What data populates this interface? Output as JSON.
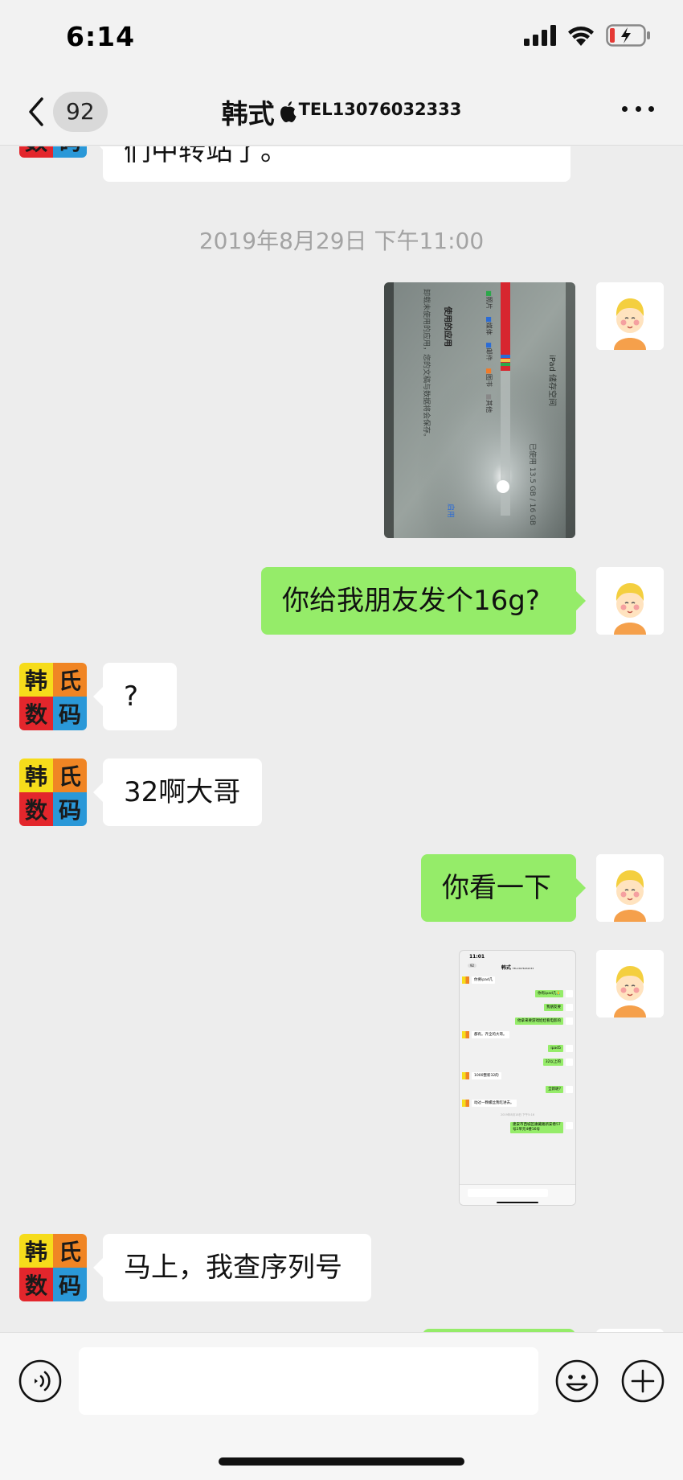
{
  "status_bar": {
    "time": "6:14"
  },
  "nav": {
    "unread_count": "92",
    "contact_name": "韩式",
    "contact_tel": "TEL13076032333"
  },
  "chat": {
    "partial_top_text": "们中转站了。",
    "timestamp": "2019年8月29日 下午11:00",
    "messages": [
      {
        "side": "out",
        "kind": "image",
        "image": "ipad-storage-photo"
      },
      {
        "side": "out",
        "kind": "text",
        "text": "你给我朋友发个16g?"
      },
      {
        "side": "in",
        "kind": "text",
        "text": "?"
      },
      {
        "side": "in",
        "kind": "text",
        "text": "32啊大哥"
      },
      {
        "side": "out",
        "kind": "text",
        "text": "你看一下"
      },
      {
        "side": "out",
        "kind": "image",
        "image": "chat-screenshot"
      },
      {
        "side": "in",
        "kind": "text",
        "text": "马上，我查序列号"
      }
    ]
  },
  "avatar_logo": {
    "chars": [
      "韩",
      "氏",
      "数",
      "码"
    ]
  },
  "photo": {
    "title": "iPad 储存空间",
    "used": "已使用 13.5 GB / 16 GB",
    "legend": [
      "照片",
      "媒体",
      "邮件",
      "图书",
      "其他"
    ],
    "section": "使用的应用",
    "hint": "卸载未使用的应用，您的文稿与数据将会保存。",
    "link": "启用"
  },
  "screenshot": {
    "time": "11:01",
    "title": "韩式",
    "tel": "TEL13076032333",
    "badge": "92",
    "rows": [
      {
        "side": "in",
        "text": "你要ipad几"
      },
      {
        "side": "out",
        "text": "你有ipad几🙏"
      },
      {
        "side": "out",
        "text": "我朋友要"
      },
      {
        "side": "out",
        "text": "他拿来要游戏娃娃看电影的"
      },
      {
        "side": "in",
        "text": "都有。齐全的大哥。"
      },
      {
        "side": "out",
        "text": "ipad5"
      },
      {
        "side": "out",
        "text": "32以上的"
      },
      {
        "side": "in",
        "text": "1000整新32的"
      },
      {
        "side": "out",
        "text": "全新呢?"
      },
      {
        "side": "in",
        "text": "动过一颗螺丝我吃进去。"
      },
      {
        "side": "time",
        "text": "2019年8月18日 下午5:16"
      },
      {
        "side": "out",
        "text": "建安市西城区康藏路新安巷57号2单元4楼16号"
      }
    ]
  },
  "colors": {
    "bubble_out": "#95ec69",
    "bubble_in": "#ffffff",
    "background": "#ededed"
  }
}
